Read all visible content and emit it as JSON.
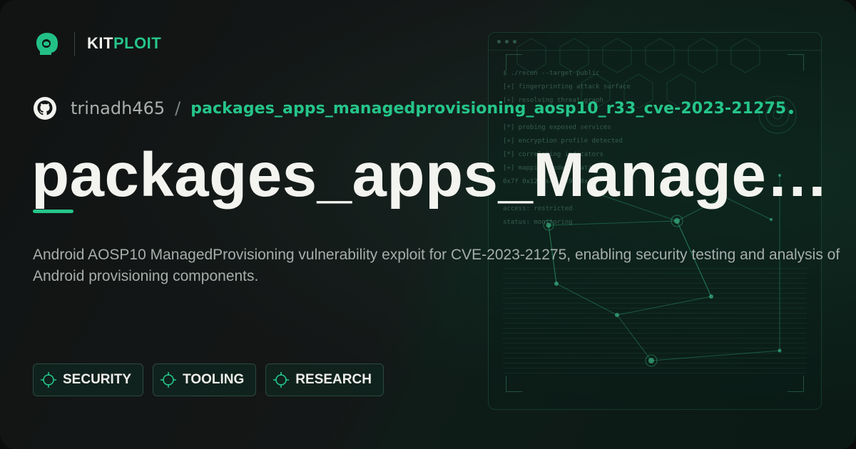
{
  "brand": {
    "part1": "KIT",
    "part2": "PLOIT"
  },
  "repo": {
    "owner": "trinadh465",
    "separator": "/",
    "name": "packages_apps_managedprovisioning_aosp10_r33_cve-2023-21275"
  },
  "title": "packages_apps_Manage…",
  "description": "Android AOSP10 ManagedProvisioning vulnerability exploit for CVE-2023-21275, enabling security testing and analysis of Android provisioning components.",
  "tags": [
    {
      "label": "SECURITY",
      "icon": "crosshair-icon"
    },
    {
      "label": "TOOLING",
      "icon": "crosshair-icon"
    },
    {
      "label": "RESEARCH",
      "icon": "crosshair-icon"
    }
  ],
  "terminal": {
    "lines": [
      "$ ./recon --target public",
      "[+] fingerprinting attack surface",
      "[+] resolving threat graph",
      "",
      "[*] probing exposed services",
      "[+] encryption profile detected",
      "[*] correlating indicators",
      "[+] mapping node relations",
      "0x7f 0x12 0x4e 0x91 0x3c",
      "",
      "access: restricted",
      "status: monitoring"
    ]
  },
  "colors": {
    "accent": "#25c58a",
    "title": "#f3f3ef",
    "muted": "#a6aeab",
    "background": "#121414"
  }
}
